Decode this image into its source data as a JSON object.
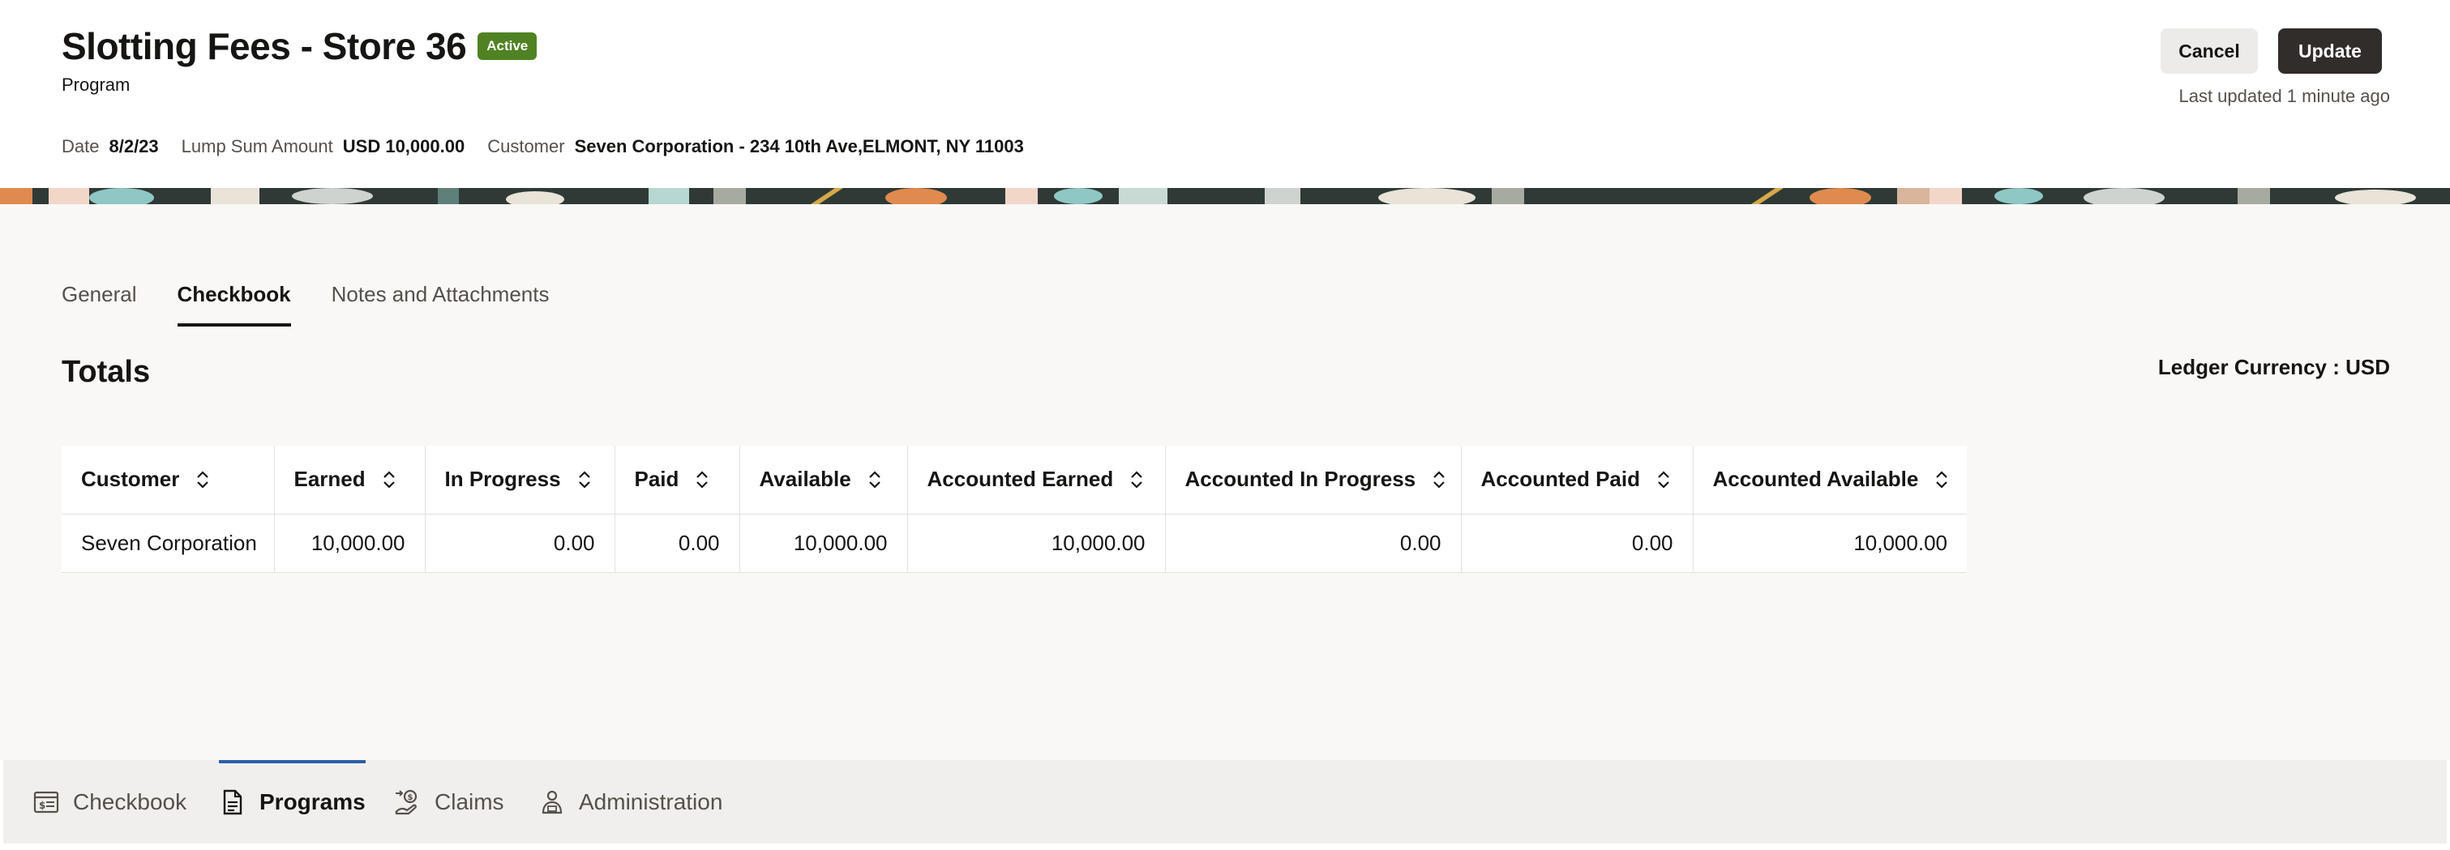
{
  "header": {
    "title": "Slotting Fees - Store 36",
    "status_badge": "Active",
    "subtitle": "Program",
    "meta": [
      {
        "label": "Date",
        "value": "8/2/23"
      },
      {
        "label": "Lump Sum Amount",
        "value": "USD 10,000.00"
      },
      {
        "label": "Customer",
        "value": "Seven Corporation - 234 10th Ave,ELMONT, NY 11003"
      }
    ],
    "cancel_label": "Cancel",
    "update_label": "Update",
    "last_updated": "Last updated 1 minute ago"
  },
  "tabs": [
    {
      "label": "General",
      "active": false
    },
    {
      "label": "Checkbook",
      "active": true
    },
    {
      "label": "Notes and Attachments",
      "active": false
    }
  ],
  "section": {
    "title": "Totals",
    "ledger_currency": "Ledger Currency : USD"
  },
  "table": {
    "columns": [
      "Customer",
      "Earned",
      "In Progress",
      "Paid",
      "Available",
      "Accounted Earned",
      "Accounted In Progress",
      "Accounted Paid",
      "Accounted Available"
    ],
    "rows": [
      [
        "Seven Corporation",
        "10,000.00",
        "0.00",
        "0.00",
        "10,000.00",
        "10,000.00",
        "0.00",
        "0.00",
        "10,000.00"
      ]
    ]
  },
  "bottom_nav": [
    {
      "label": "Checkbook",
      "icon": "checkbook-icon",
      "active": false
    },
    {
      "label": "Programs",
      "icon": "document-icon",
      "active": true
    },
    {
      "label": "Claims",
      "icon": "claims-icon",
      "active": false
    },
    {
      "label": "Administration",
      "icon": "administration-icon",
      "active": false
    }
  ],
  "colors": {
    "badge": "#508223",
    "primary_button": "#312d2a",
    "nav_active_indicator": "#2b5fa8"
  }
}
